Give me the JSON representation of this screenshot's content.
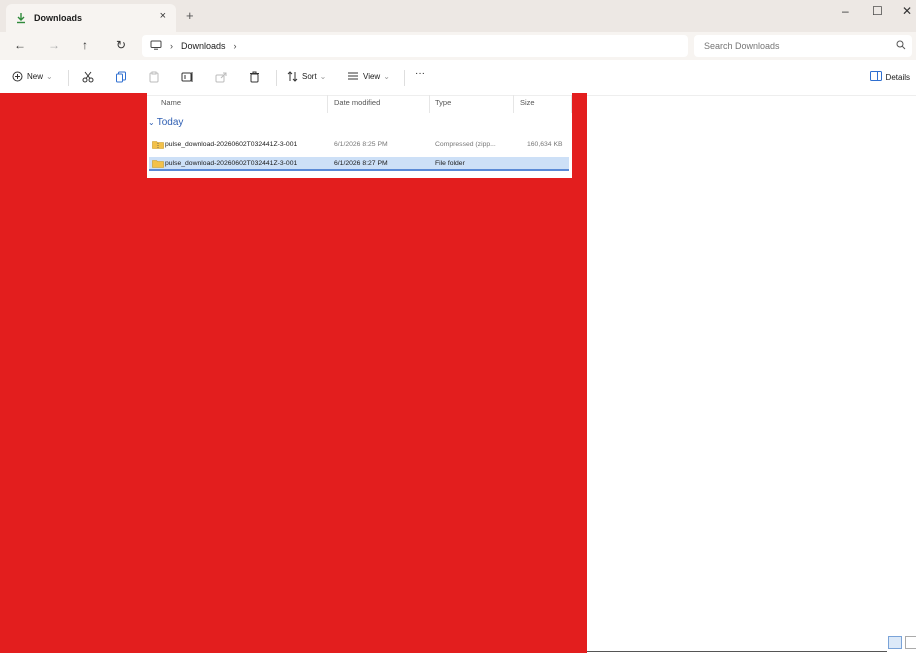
{
  "window": {
    "tab_title": "Downloads",
    "tab_close": "×",
    "new_tab": "+",
    "minimize": "–",
    "maximize": "☐",
    "close": "✕"
  },
  "address": {
    "back": "←",
    "forward": "→",
    "up": "↑",
    "refresh": "↻",
    "breadcrumb_sep": "›",
    "breadcrumb_current": "Downloads",
    "search_placeholder": "Search Downloads"
  },
  "commandbar": {
    "new_label": "New",
    "sort_label": "Sort",
    "view_label": "View",
    "more_label": "···",
    "details_label": "Details"
  },
  "columns": [
    "Name",
    "Date modified",
    "Type",
    "Size"
  ],
  "group_label": "Today",
  "files": [
    {
      "name": "pulse_download-20260602T032441Z-3-001",
      "date": "6/1/2026 8:25 PM",
      "type": "Compressed (zipp...",
      "size": "160,634 KB",
      "icon": "zip-folder-icon",
      "selected": false
    },
    {
      "name": "pulse_download-20260602T032441Z-3-001",
      "date": "6/1/2026 8:27 PM",
      "type": "File folder",
      "size": "",
      "icon": "folder-icon",
      "selected": true
    }
  ],
  "colors": {
    "redaction": "#e31e1e",
    "selection": "#cde0f7",
    "group_blue": "#2f5fb3",
    "folder_yellow": "#f3c14a"
  }
}
